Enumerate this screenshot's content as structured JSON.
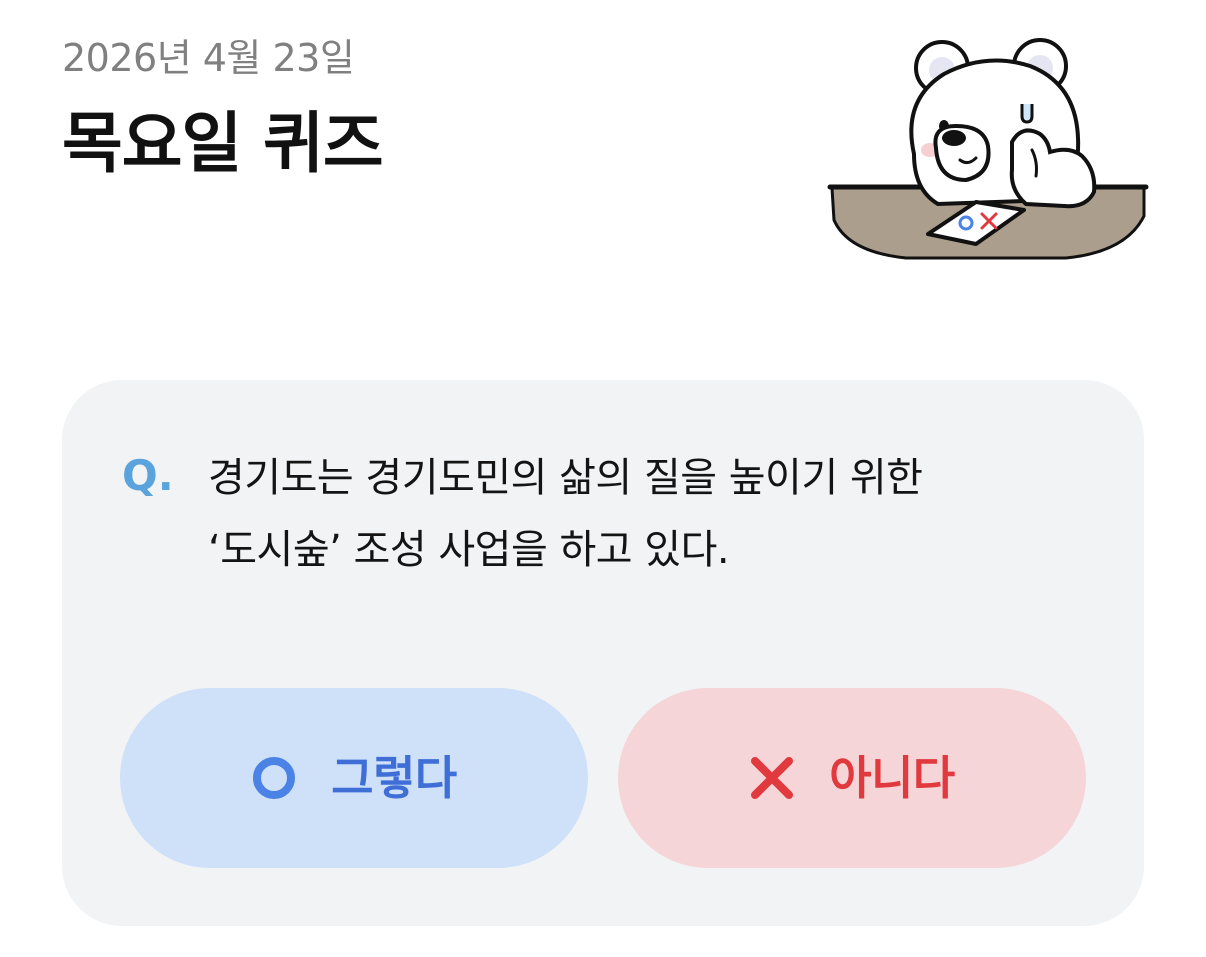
{
  "header": {
    "date": "2026년 4월 23일",
    "title": "목요일 퀴즈"
  },
  "mascot": {
    "icon": "polar-bear-quiz-mascot-icon",
    "sheet_text": "OX"
  },
  "quiz": {
    "q_prefix": "Q.",
    "question_line1": "경기도는 경기도민의 삶의 질을 높이기 위한",
    "question_line2": "‘도시숲’ 조성 사업을 하고 있다.",
    "answers": [
      {
        "label": "그렇다",
        "icon": "circle-o-icon",
        "color": "#3f6fd6",
        "background": "#cfe0f9"
      },
      {
        "label": "아니다",
        "icon": "x-mark-icon",
        "color": "#e0393e",
        "background": "#f6d5d8"
      }
    ]
  },
  "colors": {
    "card_background": "#f2f3f5",
    "q_accent": "#5aa3dd",
    "date_text": "#808080"
  }
}
